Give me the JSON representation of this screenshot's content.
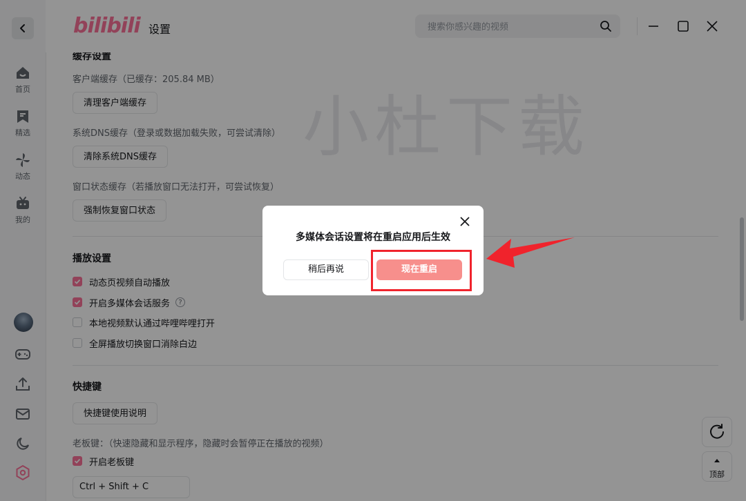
{
  "header": {
    "logo": "bilibili",
    "title": "设置",
    "search_placeholder": "搜索你感兴趣的视频"
  },
  "sidebar": {
    "items": [
      {
        "label": "首页",
        "icon": "home-icon"
      },
      {
        "label": "精选",
        "icon": "bookmark-icon"
      },
      {
        "label": "动态",
        "icon": "pinwheel-icon"
      },
      {
        "label": "我的",
        "icon": "tv-icon"
      }
    ],
    "bottom_icons": [
      "avatar",
      "gamepad-icon",
      "upload-icon",
      "mail-icon",
      "moon-icon",
      "settings-icon"
    ]
  },
  "cache": {
    "title": "缓存设置",
    "client_cache_desc": "客户端缓存（已缓存：205.84 MB）",
    "client_cache_btn": "清理客户端缓存",
    "dns_desc": "系统DNS缓存（登录或数据加载失败，可尝试清除）",
    "dns_btn": "清除系统DNS缓存",
    "window_desc": "窗口状态缓存（若播放窗口无法打开，可尝试恢复）",
    "window_btn": "强制恢复窗口状态"
  },
  "playback": {
    "title": "播放设置",
    "options": [
      {
        "label": "动态页视频自动播放",
        "checked": true
      },
      {
        "label": "开启多媒体会话服务",
        "checked": true
      },
      {
        "label": "本地视频默认通过哔哩哔哩打开",
        "checked": false
      },
      {
        "label": "全屏播放切换窗口消除白边",
        "checked": false
      }
    ],
    "help_icon": "?"
  },
  "shortcut": {
    "title": "快捷键",
    "help_btn": "快捷键使用说明",
    "boss_desc": "老板键：（快速隐藏和显示程序，隐藏时会暂停正在播放的视频）",
    "boss_enable": "开启老板键",
    "boss_enable_checked": true,
    "boss_key": "Ctrl + Shift + C"
  },
  "watermark": "小杜下载",
  "float": {
    "refresh_icon": "refresh-icon",
    "top_label": "顶部"
  },
  "dialog": {
    "message": "多媒体会话设置将在重启应用后生效",
    "later_btn": "稍后再说",
    "restart_btn": "现在重启"
  },
  "colors": {
    "brand": "#fb7299",
    "restart_btn": "#f78f8c",
    "highlight": "#f0232c"
  }
}
